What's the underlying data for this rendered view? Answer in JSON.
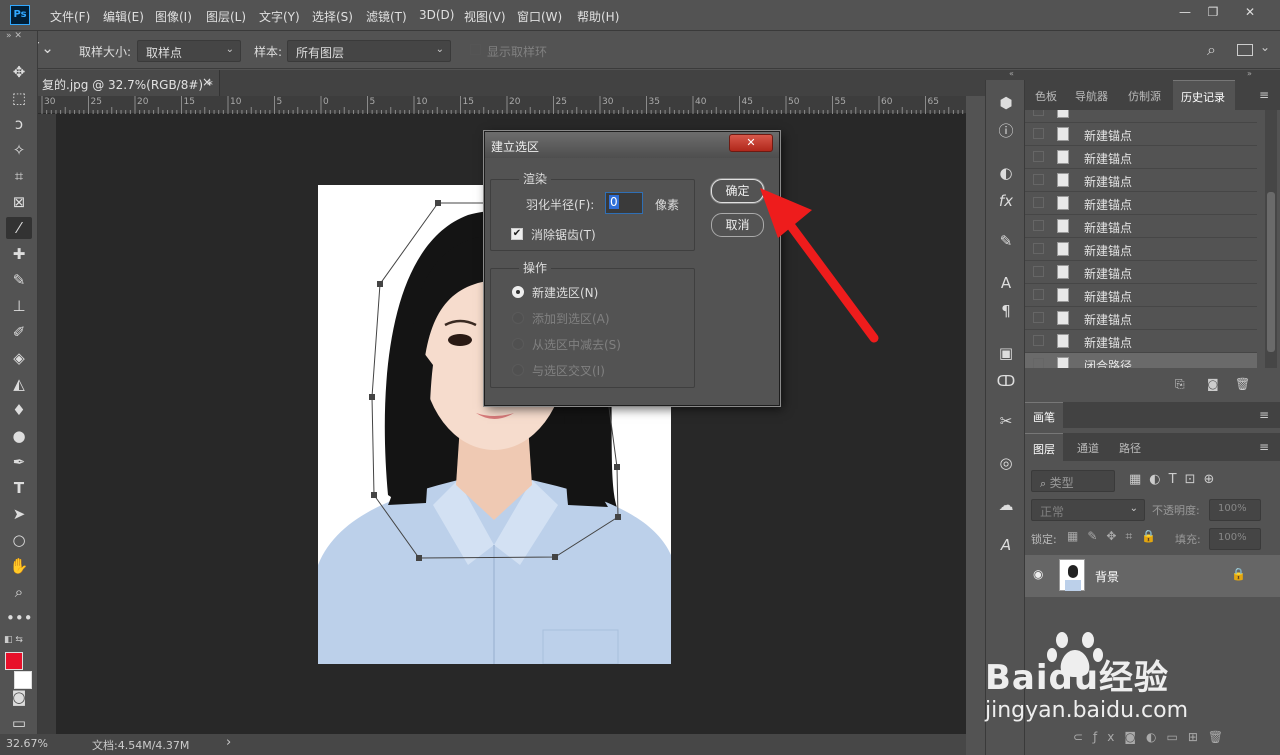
{
  "menubar": {
    "logo": "Ps",
    "items": [
      "文件(F)",
      "编辑(E)",
      "图像(I)",
      "图层(L)",
      "文字(Y)",
      "选择(S)",
      "滤镜(T)",
      "3D(D)",
      "视图(V)",
      "窗口(W)",
      "帮助(H)"
    ],
    "minimize": "—",
    "restore": "❐",
    "close": "✕"
  },
  "options": {
    "sample_size_label": "取样大小:",
    "sample_size_value": "取样点",
    "sample_label": "样本:",
    "sample_value": "所有图层",
    "show_ring": "显示取样环"
  },
  "document": {
    "tab_title": "复的.jpg @ 32.7%(RGB/8#) *",
    "tab_close": "×",
    "zoom": "32.67%",
    "doc_info": "文档:4.54M/4.37M",
    "status_arrow": "›"
  },
  "ruler": {
    "h_numbers": [
      "30",
      "25",
      "20",
      "15",
      "10",
      "5",
      "0",
      "5",
      "10",
      "15",
      "20",
      "25",
      "30",
      "35",
      "40",
      "45",
      "50",
      "55",
      "60",
      "65"
    ]
  },
  "dialog": {
    "title": "建立选区",
    "close": "✕",
    "render_group": "渲染",
    "feather_label": "羽化半径(F):",
    "feather_value": "0",
    "feather_unit": "像素",
    "antialias_label": "消除锯齿(T)",
    "antialias_checked": true,
    "ok": "确定",
    "cancel": "取消",
    "operation_group": "操作",
    "operations": [
      "新建选区(N)",
      "添加到选区(A)",
      "从选区中减去(S)",
      "与选区交叉(I)"
    ],
    "selected_operation": "新建选区(N)"
  },
  "panels": {
    "top_tabs": [
      "色板",
      "导航器",
      "仿制源",
      "历史记录"
    ],
    "active_top_tab": "历史记录",
    "history": [
      "新建锚点",
      "新建锚点",
      "新建锚点",
      "新建锚点",
      "新建锚点",
      "新建锚点",
      "新建锚点",
      "新建锚点",
      "新建锚点",
      "新建锚点",
      "闭合路径"
    ],
    "brush_tab": "画笔",
    "layer_tabs": [
      "图层",
      "通道",
      "路径"
    ],
    "filter_placeholder": "类型",
    "blend_mode": "正常",
    "opacity_label": "不透明度:",
    "opacity_value": "100%",
    "lock_label": "锁定:",
    "fill_label": "填充:",
    "fill_value": "100%",
    "layer_name": "背景"
  },
  "watermark": {
    "brand": "Baidu经验",
    "url": "jingyan.baidu.com"
  },
  "colors": {
    "foreground": "#e8102a",
    "background": "#ffffff",
    "arrow": "#ee1c1c"
  }
}
